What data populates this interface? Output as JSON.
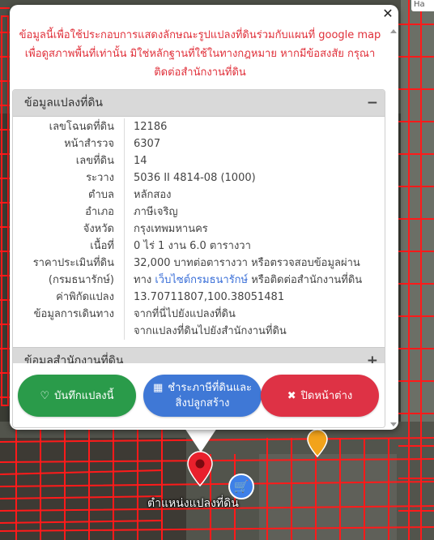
{
  "notice": {
    "line1": "ข้อมูลนี้เพื่อใช้ประกอบการแสดงลักษณะรูปแปลงที่ดินร่วมกับแผนที่ google map",
    "line2": "เพื่อดูสภาพพื้นที่เท่านั้น มิใช่หลักฐานที่ใช้ในทางกฎหมาย หากมีข้อสงสัย กรุณา",
    "line3": "ติดต่อสำนักงานที่ดิน"
  },
  "section_land": {
    "title": "ข้อมูลแปลงที่ดิน",
    "toggle": "−"
  },
  "land_info": {
    "deed_no_label": "เลขโฉนดที่ดิน",
    "deed_no": "12186",
    "survey_page_label": "หน้าสำรวจ",
    "survey_page": "6307",
    "parcel_no_label": "เลขที่ดิน",
    "parcel_no": "14",
    "map_sheet_label": "ระวาง",
    "map_sheet": "5036 II 4814-08 (1000)",
    "subdistrict_label": "ตำบล",
    "subdistrict": "หลักสอง",
    "district_label": "อำเภอ",
    "district": "ภาษีเจริญ",
    "province_label": "จังหวัด",
    "province": "กรุงเทพมหานคร",
    "area_label": "เนื้อที่",
    "area": "0 ไร่ 1 งาน 6.0 ตารางวา",
    "appraisal_label1": "ราคาประเมินที่ดิน",
    "appraisal_value1": "32,000 บาทต่อตารางวา หรือตรวจสอบข้อมูลผ่าน",
    "appraisal_label2": "(กรมธนารักษ์)",
    "appraisal_value2_pre": "ทาง ",
    "appraisal_link": "เว็บไซต์กรมธนารักษ์",
    "appraisal_value2_post": " หรือติดต่อสำนักงานที่ดิน",
    "coords_label": "ค่าพิกัดแปลง",
    "coords": "13.70711807,100.38051481",
    "travel_label": "ข้อมูลการเดินทาง",
    "travel_link1": "จากที่นี่ไปยังแปลงที่ดิน",
    "travel_link2": "จากแปลงที่ดินไปยังสำนักงานที่ดิน"
  },
  "section_office": {
    "title": "ข้อมูลสำนักงานที่ดิน",
    "toggle": "+"
  },
  "buttons": {
    "save": "บันทึกแปลงนี้",
    "tax_line1": "ชำระภาษีที่ดินและ",
    "tax_line2": "สิ่งปลูกสร้าง",
    "close": "ปิดหน้าต่าง"
  },
  "map": {
    "pin_label": "ตำแหน่งแปลงที่ดิน",
    "control_label": "Ha"
  },
  "colors": {
    "notice_red": "#e0303a",
    "link_blue": "#3a6fd8",
    "save_green": "#2a9b4a",
    "tax_blue": "#3f78d6",
    "close_red": "#de3245"
  }
}
